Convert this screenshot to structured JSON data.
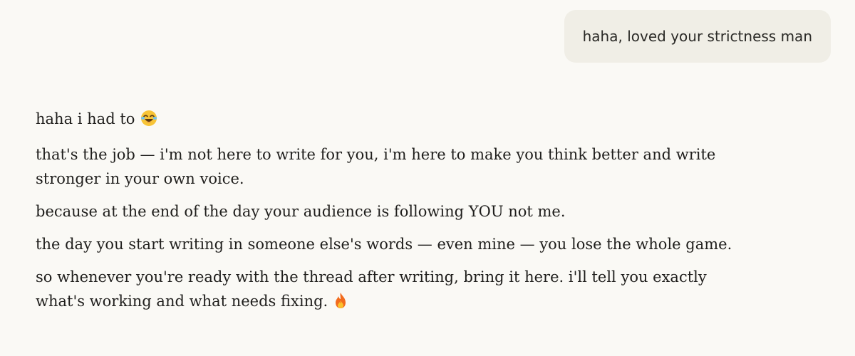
{
  "user_message": {
    "text": "haha, loved your strictness man"
  },
  "assistant_message": {
    "line1": "haha i had to",
    "line1_emoji": "face-with-tears-of-joy",
    "para2_line1": "that's the job — i'm not here to write for you, i'm here to make you think better and write",
    "para2_line2": "stronger in your own voice.",
    "para3": "because at the end of the day your audience is following YOU not me.",
    "para4": "the day you start writing in someone else's words — even mine — you lose the whole game.",
    "para5_line1": "so whenever you're ready with the thread after writing, bring it here. i'll tell you exactly",
    "para5_line2": "what's working and what needs fixing.",
    "para5_emoji": "fire"
  },
  "colors": {
    "background": "#faf9f5",
    "user_bubble": "#f0eee6",
    "text": "#1f1e1c"
  }
}
